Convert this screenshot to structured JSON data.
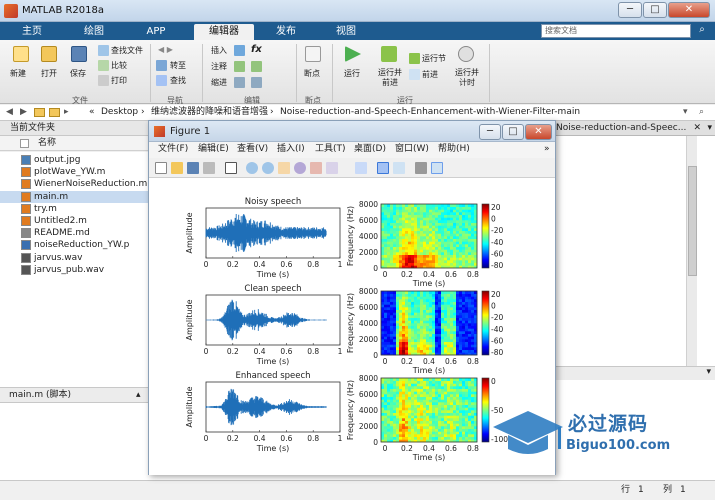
{
  "window": {
    "title": "MATLAB R2018a",
    "min_label": "─",
    "max_label": "□",
    "close_label": "✕"
  },
  "ribbon_tabs": [
    "主页",
    "绘图",
    "APP",
    "编辑器",
    "发布",
    "视图"
  ],
  "active_tab": "编辑器",
  "search_placeholder": "搜索文档",
  "ribbon": {
    "file": {
      "new": "新建",
      "open": "打开",
      "save": "保存",
      "find_files": "查找文件",
      "compare": "比较",
      "print": "打印",
      "section": "文件"
    },
    "nav": {
      "goto": "转至",
      "find": "查找",
      "section": "导航"
    },
    "edit": {
      "insert": "插入",
      "comment": "注释",
      "indent": "缩进",
      "fx": "fx",
      "section": "编辑"
    },
    "breakpoints": {
      "label": "断点",
      "section": "断点"
    },
    "run": {
      "run": "运行",
      "run_advance": "运行并前进",
      "run_section": "运行节",
      "advance": "前进",
      "run_time": "运行并计时",
      "section": "运行"
    }
  },
  "path": {
    "prefix": "«",
    "segments": [
      "Desktop",
      "维纳滤波器的降噪和语音增强",
      "Noise-reduction-and-Speech-Enhancement-with-Wiener-Filter-main"
    ]
  },
  "left_panel": {
    "title": "当前文件夹",
    "column": "名称",
    "files": [
      {
        "name": "output.jpg",
        "color": "#4a7fb5"
      },
      {
        "name": "plotWave_YW.m",
        "color": "#e07b1f"
      },
      {
        "name": "WienerNoiseReduction.m",
        "color": "#e07b1f"
      },
      {
        "name": "main.m",
        "color": "#e07b1f"
      },
      {
        "name": "try.m",
        "color": "#e07b1f"
      },
      {
        "name": "Untitled2.m",
        "color": "#e07b1f"
      },
      {
        "name": "README.md",
        "color": "#888888"
      },
      {
        "name": "noiseReduction_YW.p",
        "color": "#3a6fb0"
      },
      {
        "name": "jarvus.wav",
        "color": "#555555"
      },
      {
        "name": "jarvus_pub.wav",
        "color": "#555555"
      }
    ],
    "selected_index": 3,
    "detail": "main.m  (脚本)"
  },
  "editor_tab_text": "Noise-reduction-and-Speec...",
  "status": {
    "row_label": "行",
    "row": "1",
    "col_label": "列",
    "col": "1"
  },
  "figure": {
    "title": "Figure 1",
    "menu": [
      "文件(F)",
      "编辑(E)",
      "查看(V)",
      "插入(I)",
      "工具(T)",
      "桌面(D)",
      "窗口(W)",
      "帮助(H)"
    ],
    "menu_arrow": "»"
  },
  "chart_data": [
    {
      "type": "line",
      "title": "Noisy speech",
      "xlabel": "Time (s)",
      "ylabel": "Amplitude",
      "xlim": [
        0,
        1
      ],
      "xticks": [
        "0",
        "0.2",
        "0.4",
        "0.6",
        "0.8",
        "1"
      ]
    },
    {
      "type": "heatmap",
      "title": "",
      "xlabel": "Time (s)",
      "ylabel": "Frequency (Hz)",
      "xticks": [
        "0",
        "0.2",
        "0.4",
        "0.6",
        "0.8"
      ],
      "yticks": [
        "0",
        "2000",
        "4000",
        "6000",
        "8000"
      ],
      "colorbar_ticks": [
        "20",
        "0",
        "-20",
        "-40",
        "-60",
        "-80"
      ]
    },
    {
      "type": "line",
      "title": "Clean speech",
      "xlabel": "Time (s)",
      "ylabel": "Amplitude",
      "xlim": [
        0,
        1
      ],
      "xticks": [
        "0",
        "0.2",
        "0.4",
        "0.6",
        "0.8",
        "1"
      ]
    },
    {
      "type": "heatmap",
      "title": "",
      "xlabel": "Time (s)",
      "ylabel": "Frequency (Hz)",
      "xticks": [
        "0",
        "0.2",
        "0.4",
        "0.6",
        "0.8"
      ],
      "yticks": [
        "0",
        "2000",
        "4000",
        "6000",
        "8000"
      ],
      "colorbar_ticks": [
        "20",
        "0",
        "-20",
        "-40",
        "-60",
        "-80"
      ]
    },
    {
      "type": "line",
      "title": "Enhanced speech",
      "xlabel": "Time (s)",
      "ylabel": "Amplitude",
      "xlim": [
        0,
        1
      ],
      "xticks": [
        "0",
        "0.2",
        "0.4",
        "0.6",
        "0.8",
        "1"
      ]
    },
    {
      "type": "heatmap",
      "title": "",
      "xlabel": "Time (s)",
      "ylabel": "Frequency (Hz)",
      "xticks": [
        "0",
        "0.2",
        "0.4",
        "0.6",
        "0.8"
      ],
      "yticks": [
        "0",
        "2000",
        "4000",
        "6000",
        "8000"
      ],
      "colorbar_ticks": [
        "0",
        "-50",
        "-100"
      ]
    }
  ],
  "watermark": {
    "cn": "必过源码",
    "url": "Biguo100.com"
  }
}
